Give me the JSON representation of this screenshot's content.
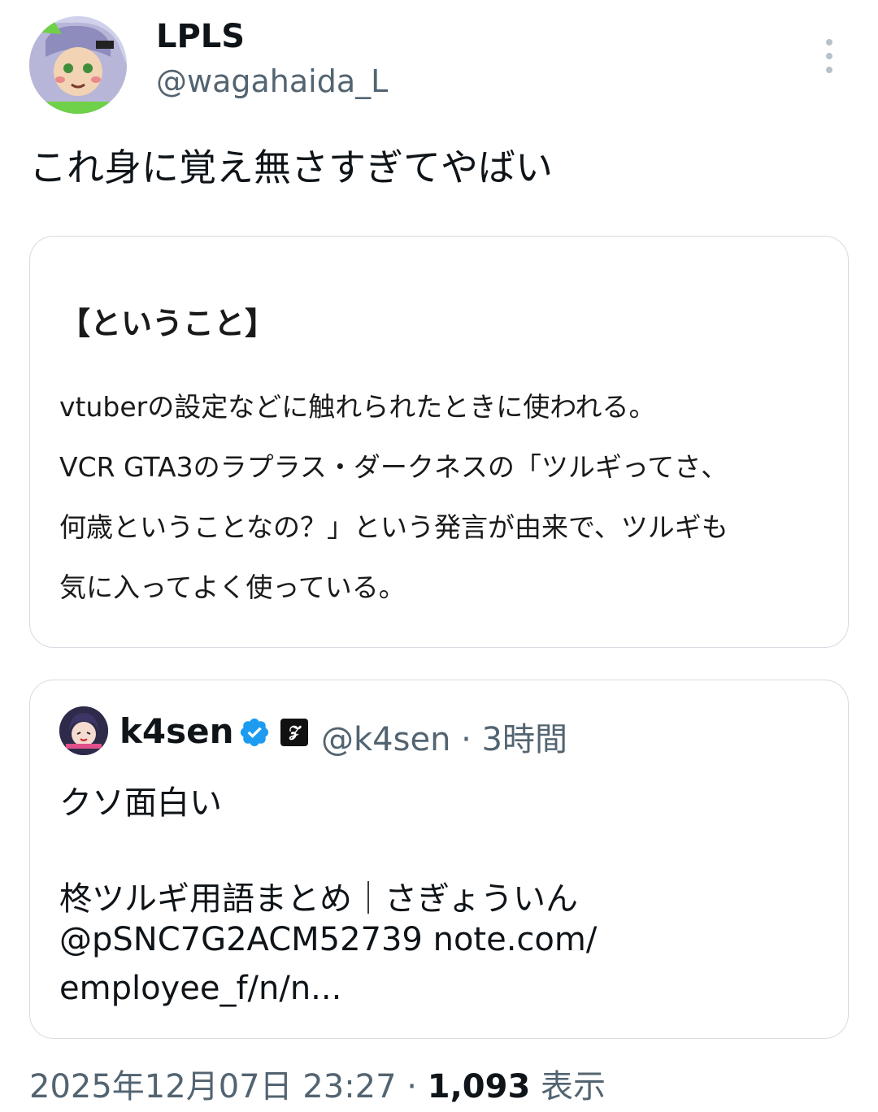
{
  "author": {
    "display_name": "LPLS",
    "handle": "@wagahaida_L"
  },
  "tweet": {
    "text": "これ身に覚え無さすぎてやばい"
  },
  "image_card": {
    "heading": "【ということ】",
    "lines": [
      "vtuberの設定などに触れられたときに使われる。",
      "VCR GTA3のラプラス・ダークネスの「ツルギってさ、",
      "何歳ということなの？」という発言が由来で、ツルギも",
      "気に入ってよく使っている。"
    ]
  },
  "quote": {
    "display_name": "k4sen",
    "badge_glyph": "𝓩",
    "handle_time": "@k4sen · 3時間",
    "text_lines": [
      "クソ面白い",
      "柊ツルギ用語まとめ｜さぎょういん",
      "@pSNC7G2ACM52739 note.com/",
      "employee_f/n/n..."
    ]
  },
  "footer": {
    "timestamp": "2025年12月07日 23:27",
    "separator": " · ",
    "views_count": "1,093",
    "views_label": " 表示"
  },
  "colors": {
    "verified": "#1d9bf0",
    "secondary_text": "#536471",
    "border": "#d6dce1"
  }
}
